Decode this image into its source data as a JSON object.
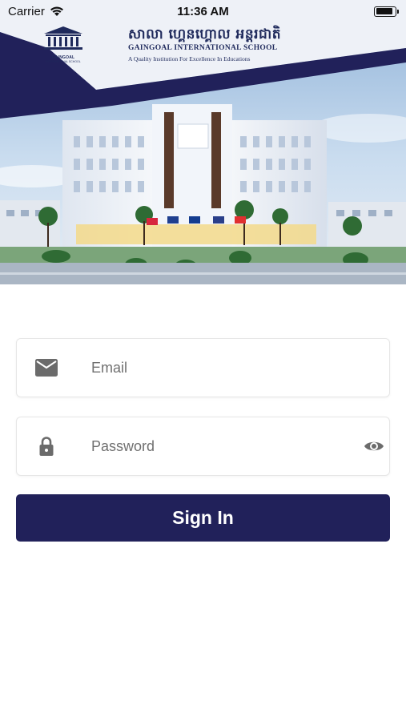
{
  "status_bar": {
    "carrier": "Carrier",
    "time": "11:36 AM",
    "battery_level": 0.9
  },
  "brand": {
    "khmer_name": "សាលា ហ្គេនហ្គោល អន្តរជាតិ",
    "english_name": "GAINGOAL INTERNATIONAL SCHOOL",
    "tagline": "A Quality Institution For Excellence In Educations",
    "logo_line1": "GAINGOAL",
    "logo_line2": "INTERNATIONAL SCHOOL",
    "primary_color": "#21215a"
  },
  "form": {
    "email_placeholder": "Email",
    "email_value": "",
    "password_placeholder": "Password",
    "password_value": "",
    "sign_in_label": "Sign In"
  },
  "icons": {
    "email": "envelope-icon",
    "password": "lock-icon",
    "toggle_visibility": "eye-icon",
    "wifi": "wifi-icon",
    "battery": "battery-icon"
  }
}
